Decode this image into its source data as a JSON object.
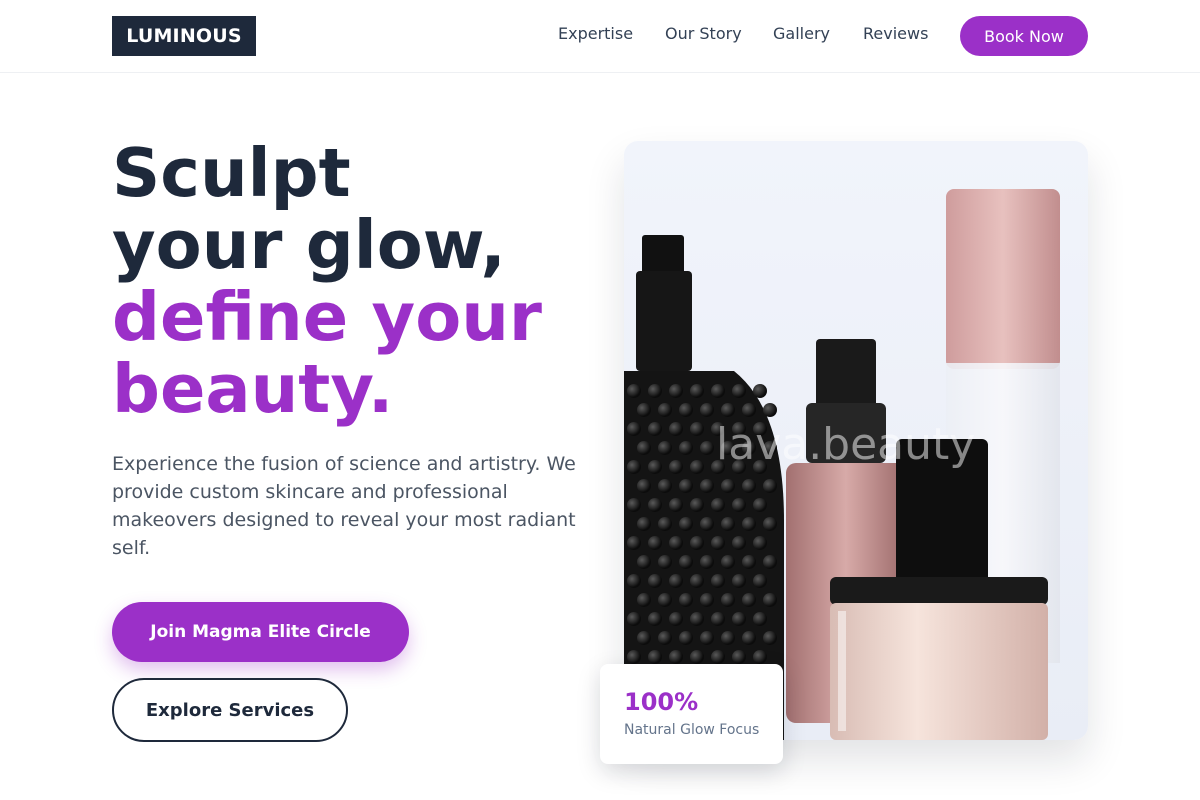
{
  "brand": {
    "logo_text": "LUMINOUS"
  },
  "nav": {
    "items": [
      "Expertise",
      "Our Story",
      "Gallery",
      "Reviews"
    ],
    "cta_label": "Book Now"
  },
  "hero": {
    "headline_dark_1": "Sculpt",
    "headline_dark_2": "your glow,",
    "headline_accent_1": "define your",
    "headline_accent_2": "beauty.",
    "description": "Experience the fusion of science and artistry. We provide custom skincare and professional makeovers designed to reveal your most radiant self.",
    "primary_cta": "Join Magma Elite Circle",
    "secondary_cta": "Explore Services"
  },
  "image": {
    "watermark": "lava.beauty",
    "subject_icon": "perfume-bottles-photo"
  },
  "stat": {
    "value": "100%",
    "label": "Natural Glow Focus"
  },
  "colors": {
    "accent": "#9b30c8",
    "dark": "#1e293b",
    "text_muted": "#4b5563"
  }
}
